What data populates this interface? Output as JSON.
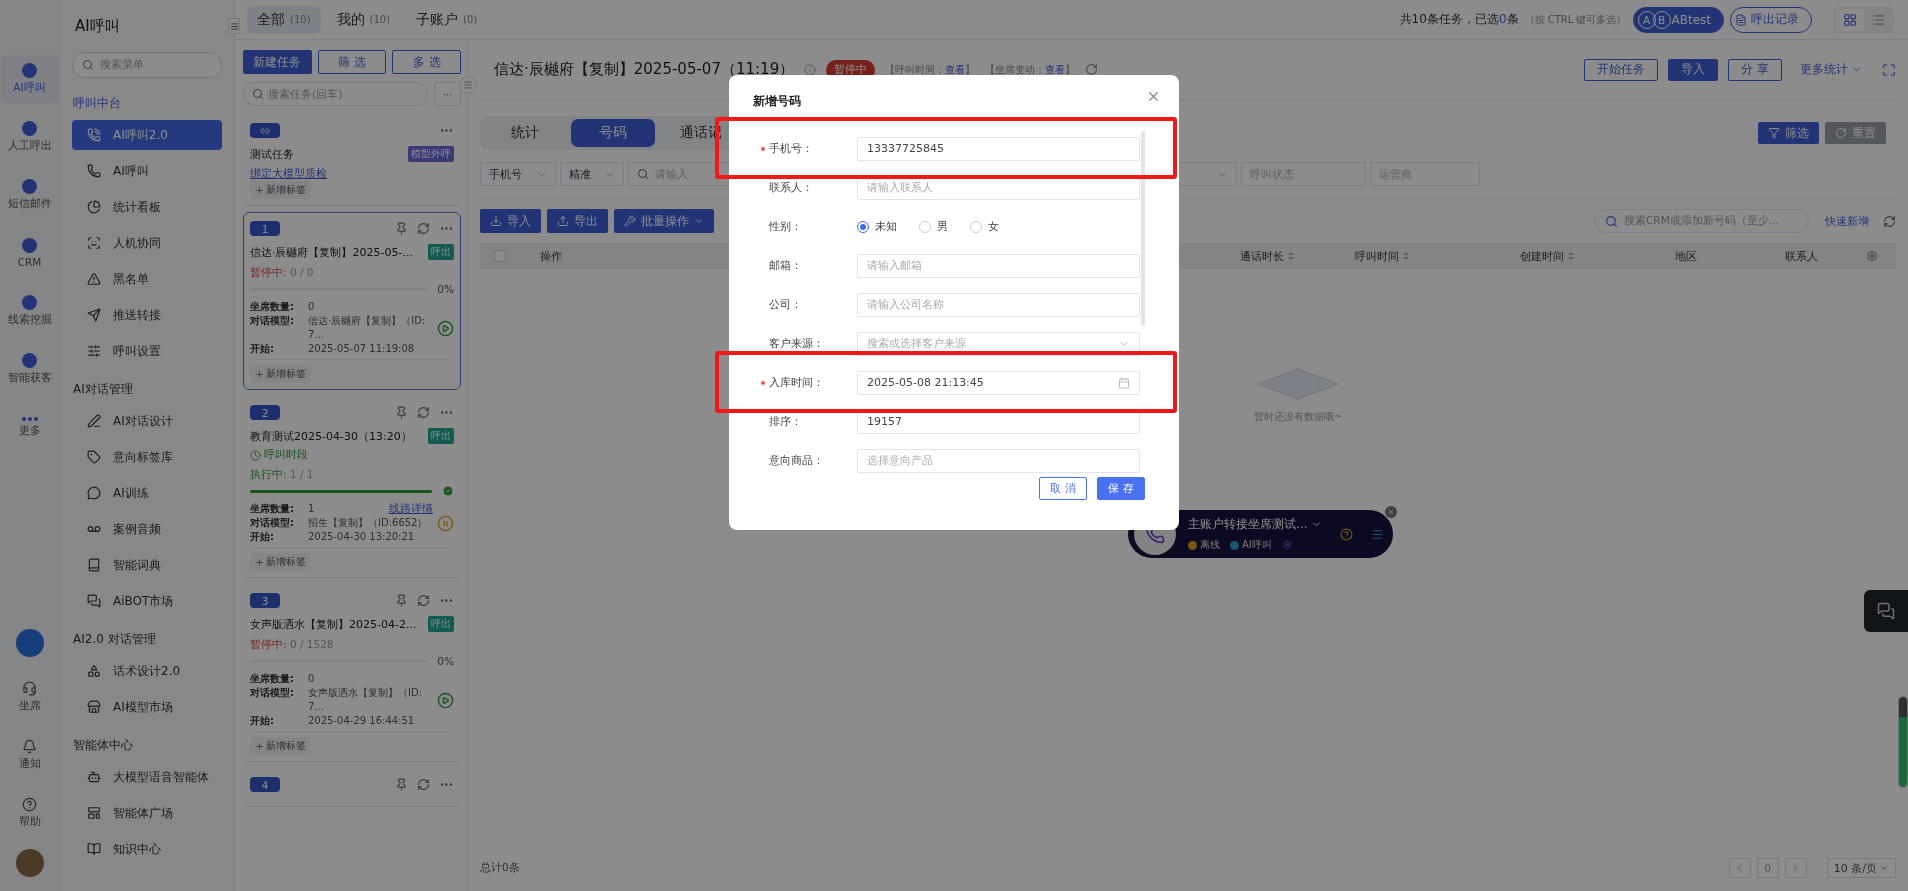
{
  "rail": {
    "items": [
      {
        "label": "AI呼叫",
        "selected": true
      },
      {
        "label": "人工呼出",
        "selected": false
      },
      {
        "label": "短信邮件",
        "selected": false
      },
      {
        "label": "CRM",
        "selected": false
      },
      {
        "label": "线索挖掘",
        "selected": false
      },
      {
        "label": "智能获客",
        "selected": false
      },
      {
        "label": "更多",
        "selected": false
      }
    ],
    "bottom": [
      "坐席",
      "通知",
      "帮助"
    ]
  },
  "menu": {
    "title": "AI呼叫",
    "search": {
      "placeholder": "搜索菜单"
    },
    "groups": [
      {
        "title": "呼叫中台",
        "items": [
          {
            "label": "AI呼叫2.0",
            "selected": true
          },
          {
            "label": "AI呼叫",
            "selected": false
          },
          {
            "label": "统计看板",
            "selected": false
          },
          {
            "label": "人机协同",
            "selected": false
          },
          {
            "label": "黑名单",
            "selected": false
          },
          {
            "label": "推送转接",
            "selected": false
          },
          {
            "label": "呼叫设置",
            "selected": false
          }
        ]
      },
      {
        "title": "AI对话管理",
        "items": [
          {
            "label": "AI对话设计",
            "selected": false
          },
          {
            "label": "意向标签库",
            "selected": false
          },
          {
            "label": "AI训练",
            "selected": false
          },
          {
            "label": "案例音频",
            "selected": false
          },
          {
            "label": "智能词典",
            "selected": false
          },
          {
            "label": "AiBOT市场",
            "selected": false
          }
        ]
      },
      {
        "title": "AI2.0 对话管理",
        "items": [
          {
            "label": "话术设计2.0",
            "selected": false
          },
          {
            "label": "AI模型市场",
            "selected": false
          }
        ]
      },
      {
        "title": "智能体中心",
        "items": [
          {
            "label": "大模型语音智能体",
            "selected": false
          },
          {
            "label": "智能体广场",
            "selected": false
          },
          {
            "label": "知识中心",
            "selected": false
          }
        ]
      }
    ]
  },
  "scope_tabs": [
    {
      "label": "全部",
      "count": "(10)",
      "selected": true
    },
    {
      "label": "我的",
      "count": "(10)",
      "selected": false
    },
    {
      "label": "子账户",
      "count": "(0)",
      "selected": false
    }
  ],
  "summary": {
    "parts": [
      "共10条任务，已选",
      "0",
      "条"
    ],
    "hint": "（按 CTRL 键可多选）"
  },
  "top_buttons": [
    {
      "label": "ABtest",
      "kind": "ab",
      "badges": [
        "A",
        "B"
      ]
    },
    {
      "label": "呼出记录",
      "kind": "outline"
    }
  ],
  "view_toggle": [
    {
      "selected": true
    },
    {
      "selected": false
    }
  ],
  "task_toolbar": {
    "buttons": [
      {
        "label": "新建任务",
        "kind": "primary"
      },
      {
        "label": "筛 选",
        "kind": "outline"
      },
      {
        "label": "多 选",
        "kind": "outline"
      }
    ],
    "search": {
      "placeholder": "搜索任务(回车)"
    },
    "more": "···"
  },
  "tasks": [
    {
      "kind": "template",
      "title": "测试任务",
      "tag": {
        "label": "模型外呼",
        "kind": "model"
      },
      "link": "绑定大模型质检",
      "add_tag": "新增标签",
      "selected": false
    },
    {
      "kind": "task",
      "number": "1",
      "title": "信达·辰樾府【复制】2025-05-...",
      "tag": {
        "label": "呼出",
        "kind": "outbound"
      },
      "status": {
        "kind": "paused",
        "label": "暂停中:",
        "value": "0 / 0"
      },
      "level": 0,
      "percent": "0%",
      "rows": [
        {
          "label": "坐席数量:",
          "value": "0"
        },
        {
          "label": "对话模型:",
          "value": "信达·辰樾府【复制】（ID:7..."
        },
        {
          "label": "开始:",
          "value": "2025-05-07 11:19:08"
        }
      ],
      "control": {
        "kind": "play"
      },
      "add_tag": "新增标签",
      "selected": true
    },
    {
      "kind": "task",
      "number": "2",
      "title": "教育测试2025-04-30（13:20）",
      "tag": {
        "label": "呼出",
        "kind": "outbound"
      },
      "schedule": "呼叫时段",
      "status": {
        "kind": "running",
        "label": "执行中:",
        "value": "1 / 1"
      },
      "level": 1,
      "rows": [
        {
          "label": "坐席数量:",
          "value": "1"
        },
        {
          "label": "对话模型:",
          "value": "招生【复制】（ID:6652）"
        },
        {
          "label": "开始:",
          "value": "2025-04-30 13:20:21"
        }
      ],
      "link": "线路详情",
      "control": {
        "kind": "pause"
      },
      "add_tag": "新增标签",
      "selected": false
    },
    {
      "kind": "task",
      "number": "3",
      "title": "女声版洒水【复制】2025-04-2...",
      "tag": {
        "label": "呼出",
        "kind": "outbound"
      },
      "status": {
        "kind": "paused",
        "label": "暂停中:",
        "value": "0 / 1528"
      },
      "level": 0,
      "percent": "0%",
      "rows": [
        {
          "label": "坐席数量:",
          "value": "0"
        },
        {
          "label": "对话模型:",
          "value": "女声版洒水【复制】（ID:7..."
        },
        {
          "label": "开始:",
          "value": "2025-04-29 16:44:51"
        }
      ],
      "control": {
        "kind": "play"
      },
      "add_tag": "新增标签",
      "selected": false
    },
    {
      "kind": "task",
      "number": "4",
      "selected": false
    }
  ],
  "detail": {
    "title": "信达·辰樾府【复制】2025-05-07（11:19）",
    "status": "暂停中",
    "meta": [
      {
        "label": "【呼叫时间：",
        "link": "查看",
        "end": "】"
      },
      {
        "label": "【坐席变动：",
        "link": "查看",
        "end": "】"
      }
    ],
    "actions": [
      {
        "label": "开始任务",
        "kind": "outline"
      },
      {
        "label": "导入",
        "kind": "primary"
      },
      {
        "label": "分 享",
        "kind": "outline"
      }
    ],
    "more": "更多统计",
    "tabs": [
      {
        "label": "统计",
        "selected": false
      },
      {
        "label": "号码",
        "selected": true
      },
      {
        "label": "通话记",
        "selected": false
      }
    ],
    "filter_buttons": [
      {
        "label": "筛选",
        "kind": "primary"
      },
      {
        "label": "重置",
        "kind": "gray"
      }
    ],
    "filters": [
      {
        "kind": "select",
        "value": "手机号"
      },
      {
        "kind": "select",
        "value": "精准"
      },
      {
        "kind": "search",
        "placeholder": "请输入"
      },
      {
        "kind": "select"
      },
      {
        "kind": "input",
        "placeholder": "呼叫状态"
      },
      {
        "kind": "input",
        "placeholder": "运营商"
      }
    ],
    "bulk_buttons": [
      {
        "label": "导入"
      },
      {
        "label": "导出"
      },
      {
        "label": "批量操作",
        "dropdown": true
      }
    ],
    "crm_search": {
      "placeholder": "搜索CRM或添加新号码（至少..."
    },
    "quick_add": "快速新增",
    "table": {
      "select_all": {
        "checked": false
      },
      "columns": [
        {
          "label": "操作",
          "sortable": false
        },
        {
          "label": "通话时长",
          "sortable": true
        },
        {
          "label": "呼叫时间",
          "sortable": true
        },
        {
          "label": "创建时间",
          "sortable": true
        },
        {
          "label": "地区",
          "sortable": false
        },
        {
          "label": "联系人",
          "sortable": false
        }
      ],
      "empty": "暂时还没有数据哦~"
    },
    "total": "总计0条",
    "pagination": {
      "page": "0",
      "page_size": "10 条/页"
    }
  },
  "phone_widget": {
    "title": "主账户转接坐席测试...",
    "status": "离线",
    "mode": "AI呼叫"
  },
  "modal": {
    "title": "新增号码",
    "fields": [
      {
        "kind": "input",
        "label": "手机号：",
        "required": true,
        "highlighted": true,
        "value": "13337725845"
      },
      {
        "kind": "input",
        "label": "联系人：",
        "required": false,
        "highlighted": false,
        "placeholder": "请输入联系人"
      },
      {
        "kind": "radio",
        "label": "性别：",
        "required": false,
        "highlighted": false,
        "options": [
          {
            "label": "未知",
            "selected": true
          },
          {
            "label": "男",
            "selected": false
          },
          {
            "label": "女",
            "selected": false
          }
        ]
      },
      {
        "kind": "input",
        "label": "邮箱：",
        "required": false,
        "highlighted": false,
        "placeholder": "请输入邮箱"
      },
      {
        "kind": "input",
        "label": "公司：",
        "required": false,
        "highlighted": false,
        "placeholder": "请输入公司名称"
      },
      {
        "kind": "select",
        "label": "客户来源：",
        "required": false,
        "highlighted": false,
        "placeholder": "搜索或选择客户来源"
      },
      {
        "kind": "date",
        "label": "入库时间：",
        "required": true,
        "highlighted": true,
        "value": "2025-05-08 21:13:45"
      },
      {
        "kind": "input",
        "label": "排序：",
        "required": false,
        "highlighted": false,
        "value": "19157"
      },
      {
        "kind": "input",
        "label": "意向商品：",
        "required": false,
        "highlighted": false,
        "placeholder": "选择意向产品"
      }
    ],
    "buttons": [
      {
        "label": "取 消",
        "kind": "default"
      },
      {
        "label": "保 存",
        "kind": "primary"
      }
    ]
  }
}
